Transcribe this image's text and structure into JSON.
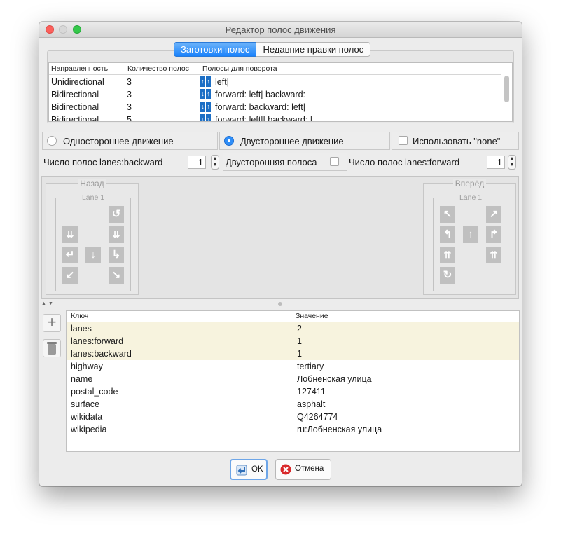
{
  "window": {
    "title": "Редактор полос движения"
  },
  "tabs": [
    {
      "label": "Заготовки полос",
      "active": true
    },
    {
      "label": "Недавние правки полос",
      "active": false
    }
  ],
  "presets": {
    "columns": [
      "Направленность",
      "Количество полос",
      "Полосы для поворота"
    ],
    "rows": [
      {
        "direction": "Unidirectional",
        "count": "3",
        "turn": "left||"
      },
      {
        "direction": "Bidirectional",
        "count": "3",
        "turn": "forward: left| backward:"
      },
      {
        "direction": "Bidirectional",
        "count": "3",
        "turn": "forward:  backward: left|"
      },
      {
        "direction": "Bidirectional",
        "count": "5",
        "turn": "forward: left|| backward: |"
      }
    ]
  },
  "options": {
    "oneway_label": "Одностороннее движение",
    "twoway_label": "Двустороннее движение",
    "selected": "twoway",
    "use_none_label": "Использовать \"none\"",
    "use_none_checked": false
  },
  "lanes_config": {
    "backward_label": "Число полос lanes:backward",
    "backward_value": "1",
    "both_label": "Двусторонняя полоса",
    "both_checked": false,
    "forward_label": "Число полос lanes:forward",
    "forward_value": "1"
  },
  "lane_groups": {
    "backward_title": "Назад",
    "forward_title": "Вперёд",
    "lane_label": "Lane 1"
  },
  "tags": {
    "columns": [
      "Ключ",
      "Значение"
    ],
    "rows": [
      {
        "key": "lanes",
        "value": "2",
        "highlight": true
      },
      {
        "key": "lanes:forward",
        "value": "1",
        "highlight": true
      },
      {
        "key": "lanes:backward",
        "value": "1",
        "highlight": true
      },
      {
        "key": "highway",
        "value": "tertiary",
        "highlight": false
      },
      {
        "key": "name",
        "value": "Лобненская улица",
        "highlight": false
      },
      {
        "key": "postal_code",
        "value": "127411",
        "highlight": false
      },
      {
        "key": "surface",
        "value": "asphalt",
        "highlight": false
      },
      {
        "key": "wikidata",
        "value": "Q4264774",
        "highlight": false
      },
      {
        "key": "wikipedia",
        "value": "ru:Лобненская улица",
        "highlight": false
      }
    ]
  },
  "footer": {
    "ok_label": "OK",
    "cancel_label": "Отмена"
  },
  "colors": {
    "accent": "#2f8ef8",
    "highlight_row": "#f7f3de",
    "lane_icon": "#1d6fc5"
  }
}
